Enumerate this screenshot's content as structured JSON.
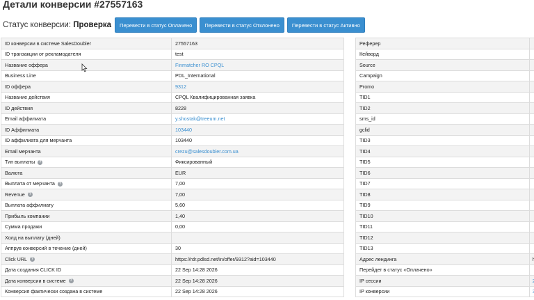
{
  "page": {
    "title": "Детали конверсии #27557163"
  },
  "status": {
    "label": "Статус конверсии:",
    "value": "Проверка",
    "buttons": [
      "Перевести в статус Оплачено",
      "Перевести в статус Отклонено",
      "Перевести в статус Активно"
    ]
  },
  "colors": {
    "accent": "#3a8fd0",
    "row_odd": "#f3f3f3",
    "border": "#dcdcdc"
  },
  "left_rows": [
    {
      "key": "ID конверсии в системе SalesDoubler",
      "value": "27557163"
    },
    {
      "key": "ID транзакции от рекламодателя",
      "value": "test"
    },
    {
      "key": "Название оффера",
      "value": "Finmatcher RO CPQL",
      "link": true
    },
    {
      "key": "Business Line",
      "value": "PDL_International"
    },
    {
      "key": "ID оффера",
      "value": "9312",
      "link": true
    },
    {
      "key": "Название действия",
      "value": "CPQL Квалифицированная заявка"
    },
    {
      "key": "ID действия",
      "value": "8228"
    },
    {
      "key": "Email аффилиата",
      "value": "y.shostak@treeum.net",
      "link": true
    },
    {
      "key": "ID Аффилиата",
      "value": "103440",
      "link": true
    },
    {
      "key": "ID аффилиата для мерчанта",
      "value": "103440"
    },
    {
      "key": "Email мерчанта",
      "value": "crezu@salesdoubler.com.ua",
      "link": true
    },
    {
      "key": "Тип выплаты",
      "value": "Фиксированный",
      "help": true
    },
    {
      "key": "Валюта",
      "value": "EUR"
    },
    {
      "key": "Выплата от мерчанта",
      "value": "7,00",
      "help": true
    },
    {
      "key": "Revenue",
      "value": "7,00",
      "help": true
    },
    {
      "key": "Выплата аффилиату",
      "value": "5,60"
    },
    {
      "key": "Прибыль компании",
      "value": "1,40"
    },
    {
      "key": "Сумма продажи",
      "value": "0,00"
    },
    {
      "key": "Холд на выплату (дней)",
      "value": ""
    },
    {
      "key": "Аппрув конверсий в течение (дней)",
      "value": "30"
    },
    {
      "key": "Click URL",
      "value": "https://rdr.pdlsd.net/in/offer/9312?aid=103440",
      "help": true
    },
    {
      "key": "Дата создания CLICK ID",
      "value": "22 Sep 14:28 2026"
    },
    {
      "key": "Дата конверсии в системе",
      "value": "22 Sep 14:28 2026",
      "help": true
    },
    {
      "key": "Конверсия фактически создана в системе",
      "value": "22 Sep 14:28 2026"
    }
  ],
  "right_rows": [
    {
      "key": "Реферер",
      "value": ""
    },
    {
      "key": "Кейворд",
      "value": ""
    },
    {
      "key": "Source",
      "value": ""
    },
    {
      "key": "Campaign",
      "value": ""
    },
    {
      "key": "Promo",
      "value": ""
    },
    {
      "key": "TID1",
      "value": ""
    },
    {
      "key": "TID2",
      "value": ""
    },
    {
      "key": "sms_id",
      "value": ""
    },
    {
      "key": "gclid",
      "value": ""
    },
    {
      "key": "TID3",
      "value": ""
    },
    {
      "key": "TID4",
      "value": ""
    },
    {
      "key": "TID5",
      "value": ""
    },
    {
      "key": "TID6",
      "value": ""
    },
    {
      "key": "TID7",
      "value": ""
    },
    {
      "key": "TID8",
      "value": ""
    },
    {
      "key": "TID9",
      "value": ""
    },
    {
      "key": "TID10",
      "value": ""
    },
    {
      "key": "TID11",
      "value": ""
    },
    {
      "key": "TID12",
      "value": ""
    },
    {
      "key": "TID13",
      "value": ""
    },
    {
      "key": "Адрес лендинга",
      "value": "h"
    },
    {
      "key": "Перейдет в статус «Оплачено»",
      "value": ""
    },
    {
      "key": "IP сессии",
      "value": "2",
      "link": true
    },
    {
      "key": "IP конверсии",
      "value": "3",
      "link": true
    }
  ]
}
